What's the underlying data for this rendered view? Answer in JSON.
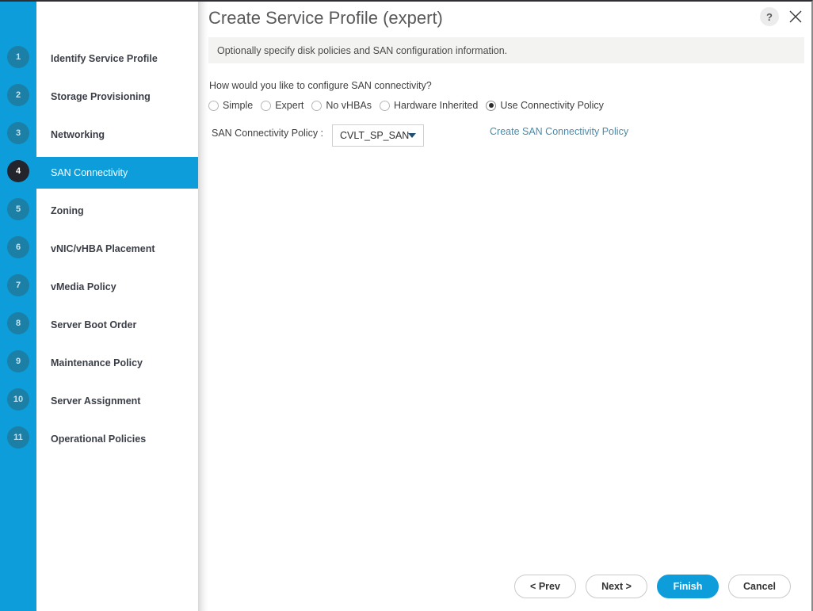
{
  "window": {
    "title": "Create Service Profile (expert)",
    "subtitle": "Optionally specify disk policies and SAN configuration information.",
    "help_glyph": "?",
    "help_icon": "question-mark-icon",
    "close_icon": "close-icon"
  },
  "theme": {
    "accent": "#0d9ddb",
    "rail": "#0d9ddb",
    "active_badge": "#24242c",
    "inactive_badge": "#1b7fa6",
    "link": "#4b8aa8",
    "subtitle_bar": "#f3f3f1",
    "title_text": "#58595b"
  },
  "sidebar": {
    "active_index": 3,
    "steps": [
      {
        "number": "1",
        "label": "Identify Service Profile"
      },
      {
        "number": "2",
        "label": "Storage Provisioning"
      },
      {
        "number": "3",
        "label": "Networking"
      },
      {
        "number": "4",
        "label": "SAN Connectivity"
      },
      {
        "number": "5",
        "label": "Zoning"
      },
      {
        "number": "6",
        "label": "vNIC/vHBA Placement"
      },
      {
        "number": "7",
        "label": "vMedia Policy"
      },
      {
        "number": "8",
        "label": "Server Boot Order"
      },
      {
        "number": "9",
        "label": "Maintenance Policy"
      },
      {
        "number": "10",
        "label": "Server Assignment"
      },
      {
        "number": "11",
        "label": "Operational Policies"
      }
    ]
  },
  "main": {
    "question": "How would you like to configure SAN connectivity?",
    "connectivity_options": [
      {
        "label": "Simple",
        "selected": false
      },
      {
        "label": "Expert",
        "selected": false
      },
      {
        "label": "No vHBAs",
        "selected": false
      },
      {
        "label": "Hardware Inherited",
        "selected": false
      },
      {
        "label": "Use Connectivity Policy",
        "selected": true
      }
    ],
    "policy_field": {
      "label": "SAN Connectivity Policy :",
      "value": "CVLT_SP_SAN",
      "caret_icon": "chevron-down-icon"
    },
    "create_policy_link": "Create SAN Connectivity Policy"
  },
  "footer": {
    "prev_label": "< Prev",
    "next_label": "Next >",
    "finish_label": "Finish",
    "cancel_label": "Cancel"
  }
}
